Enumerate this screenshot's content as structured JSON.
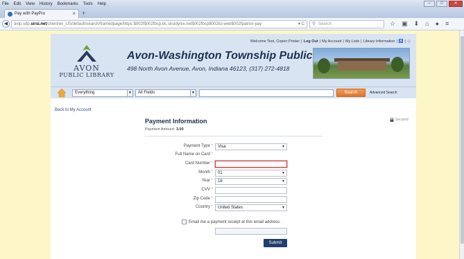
{
  "browser": {
    "menu": [
      "File",
      "Edit",
      "View",
      "History",
      "Bookmarks",
      "Tools",
      "Help"
    ],
    "tab_title": "Pay with PayPro",
    "url_prefix": "avtp.sdp.",
    "url_host": "sirsi.net",
    "url_rest": "/client/en_US/default/search/framedpage/https:$002f$002fbcp.bc.sirsidynix.net$002fbcp$002fcl-web$002fpatron-pay",
    "search_placeholder": "Search"
  },
  "header": {
    "logo_text": "AVON",
    "logo_subtext": "PUBLIC LIBRARY",
    "welcome_text": "Welcome Test, Copier Printer",
    "links": [
      "Log Out",
      "My Account",
      "My Lists",
      "Library Information"
    ],
    "title": "Avon-Washington Township Public Library",
    "address": "498 North Avon Avenue, Avon, Indiana 46123, (317) 272-4818"
  },
  "search": {
    "library_select": "Everything",
    "field_select": "All Fields",
    "button": "Search",
    "advanced": "Advanced Search"
  },
  "back_link": "Back to My Account",
  "payment": {
    "title": "Payment Information",
    "amount_label": "Payment Amount:",
    "amount": "3.00",
    "secured": "Secured",
    "fields": [
      {
        "label": "Payment Type",
        "value": "Visa",
        "type": "select"
      },
      {
        "label": "Full Name on Card",
        "value": "",
        "type": "text"
      },
      {
        "label": "Card Number",
        "value": "",
        "type": "text"
      },
      {
        "label": "Month",
        "value": "01",
        "type": "select"
      },
      {
        "label": "Year",
        "value": "16",
        "type": "select"
      },
      {
        "label": "CVV",
        "value": "",
        "type": "text"
      },
      {
        "label": "Zip Code",
        "value": "",
        "type": "text"
      },
      {
        "label": "Country",
        "value": "United States",
        "type": "select"
      }
    ],
    "email_label": "Email me a payment receipt at this email address:",
    "submit": "Submit"
  },
  "colors": {
    "page_bg": "#fdf6c8",
    "header_bg": "#d8e4f1",
    "title_color": "#1e2f52",
    "search_button": "#e2742c",
    "submit_button": "#1f3f6e"
  }
}
